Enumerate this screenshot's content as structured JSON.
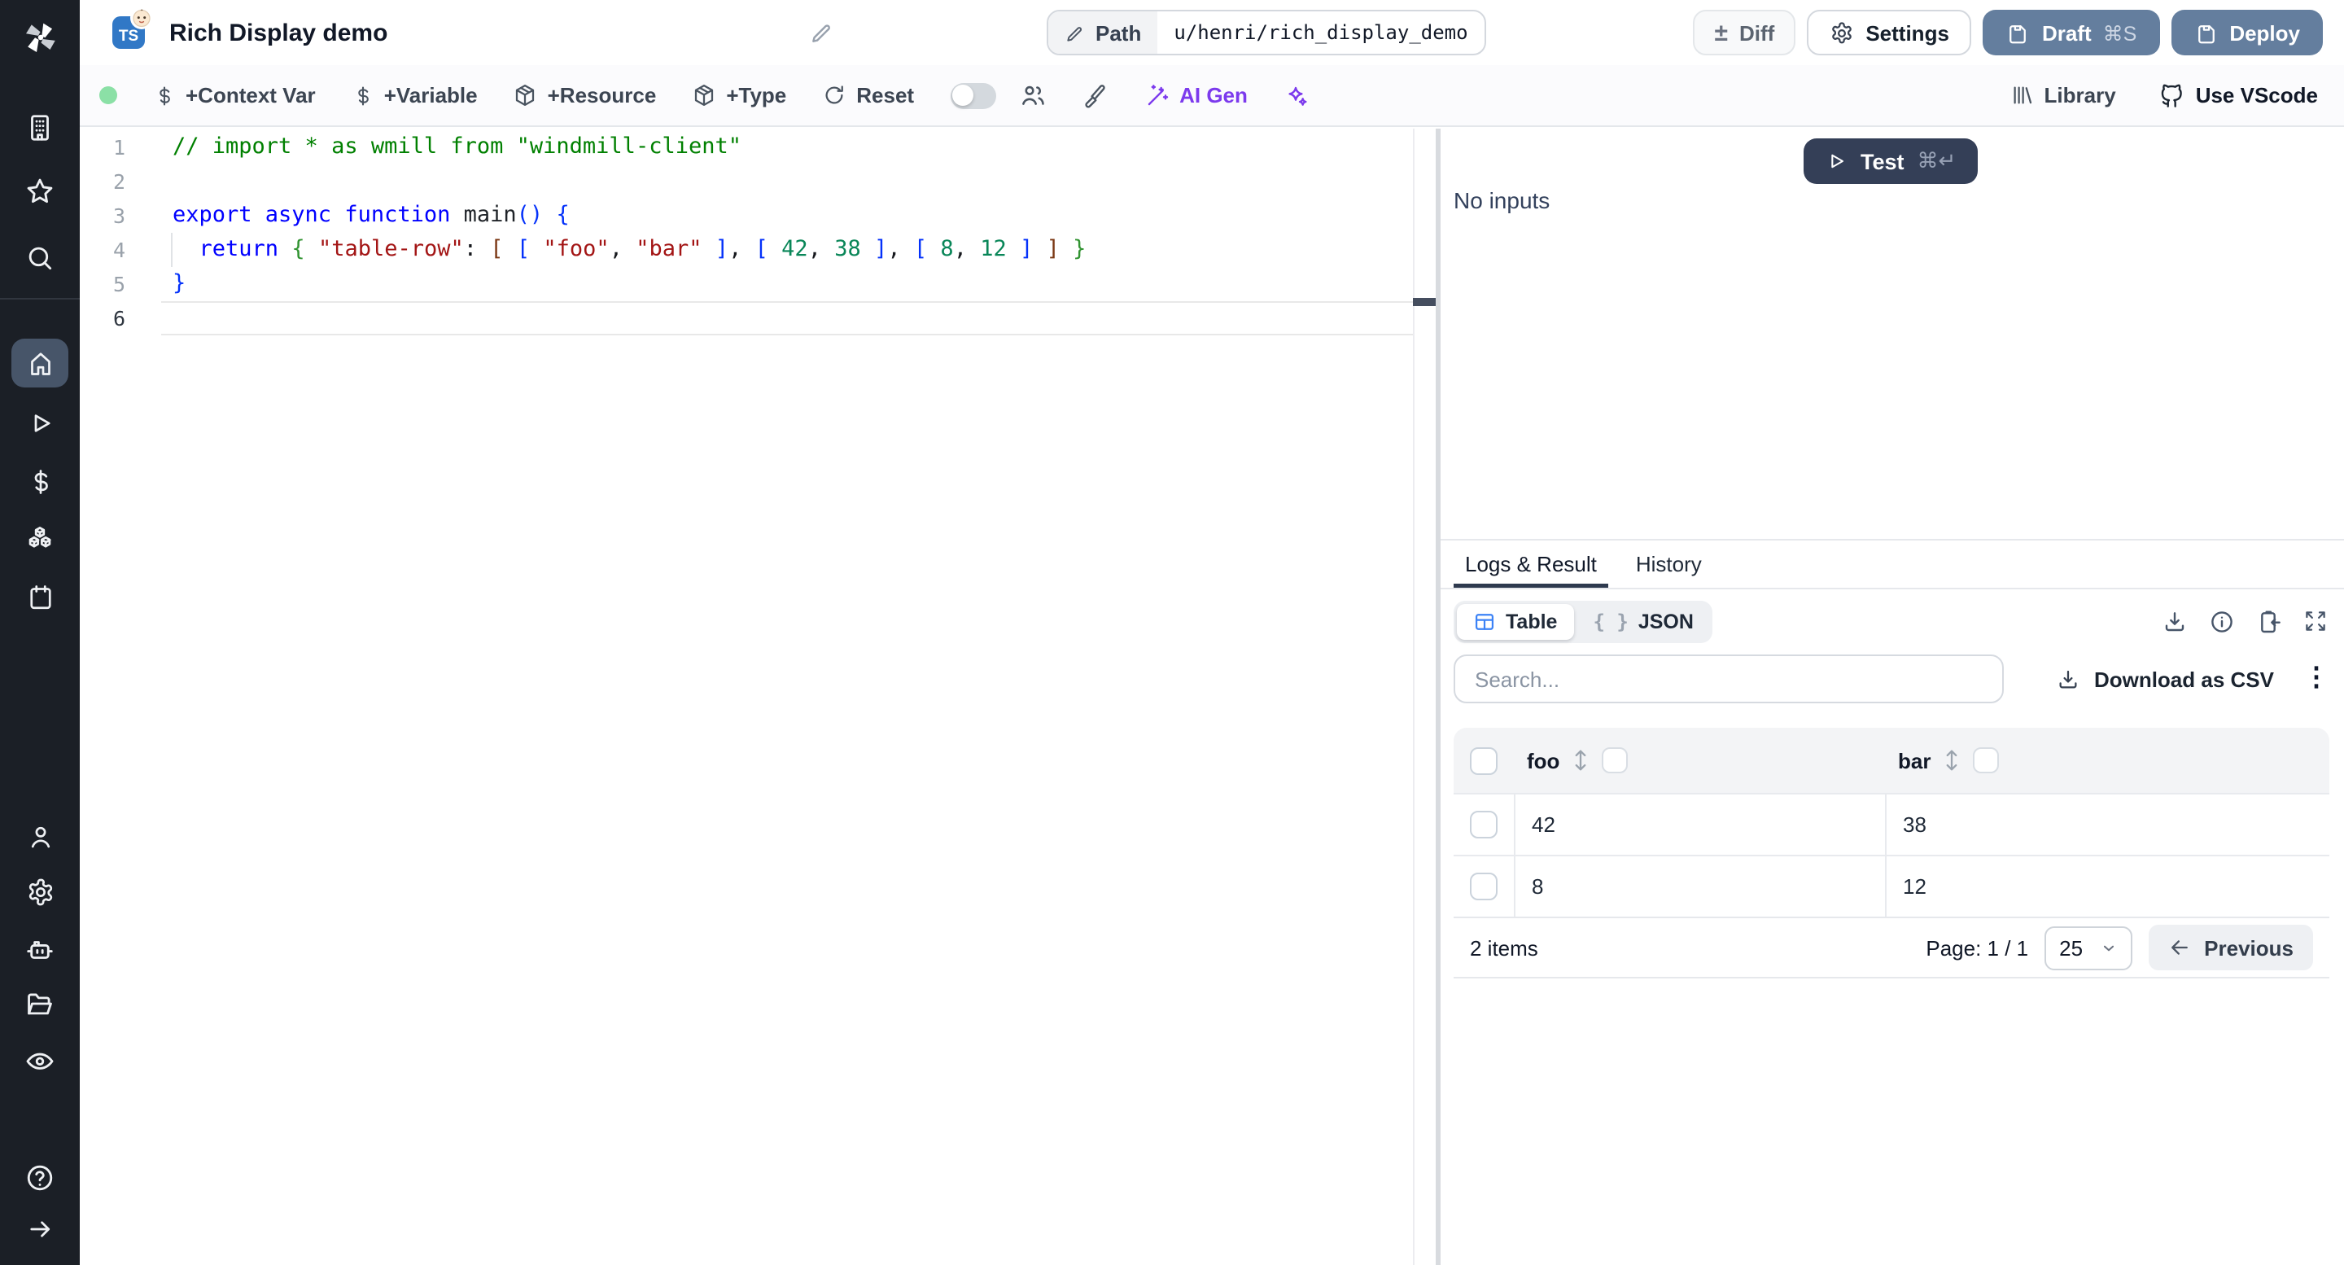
{
  "topbar": {
    "title": "Rich Display demo",
    "path_label": "Path",
    "path_value": "u/henri/rich_display_demo",
    "diff": "Diff",
    "settings": "Settings",
    "draft": "Draft",
    "draft_shortcut": "⌘S",
    "deploy": "Deploy"
  },
  "toolbar": {
    "context_var": "+Context Var",
    "variable": "+Variable",
    "resource": "+Resource",
    "type": "+Type",
    "reset": "Reset",
    "ai_gen": "AI Gen",
    "library": "Library",
    "vscode": "Use VScode",
    "accent_purple": "#7c3aed",
    "status_color": "#8be0a6"
  },
  "sidebar": {
    "icons": [
      "windmill-logo",
      "building",
      "star",
      "search",
      "home",
      "play",
      "dollar",
      "boxes",
      "calendar",
      "user",
      "settings",
      "bot",
      "folder-open",
      "eye",
      "help-circle",
      "arrow-right"
    ],
    "active_item": "home"
  },
  "icons_glyphs": {
    "plus_minus": "±",
    "kebab": "⋮",
    "braces": "{ }"
  },
  "editor": {
    "language_badge": "TS",
    "lines": [
      {
        "n": 1,
        "tokens": [
          {
            "c": "cmt",
            "t": "// import * as wmill from \"windmill-client\""
          }
        ]
      },
      {
        "n": 2,
        "tokens": []
      },
      {
        "n": 3,
        "tokens": [
          {
            "c": "kw",
            "t": "export async function "
          },
          {
            "c": "fn",
            "t": "main"
          },
          {
            "c": "b1",
            "t": "()"
          },
          {
            "c": "pl",
            "t": " "
          },
          {
            "c": "b1",
            "t": "{"
          }
        ]
      },
      {
        "n": 4,
        "tokens": [
          {
            "c": "pl",
            "t": "  "
          },
          {
            "c": "kw",
            "t": "return"
          },
          {
            "c": "pl",
            "t": " "
          },
          {
            "c": "b2",
            "t": "{"
          },
          {
            "c": "pl",
            "t": " "
          },
          {
            "c": "str",
            "t": "\"table-row\""
          },
          {
            "c": "pl",
            "t": ": "
          },
          {
            "c": "b3",
            "t": "["
          },
          {
            "c": "pl",
            "t": " "
          },
          {
            "c": "b1",
            "t": "["
          },
          {
            "c": "pl",
            "t": " "
          },
          {
            "c": "str",
            "t": "\"foo\""
          },
          {
            "c": "pl",
            "t": ", "
          },
          {
            "c": "str",
            "t": "\"bar\""
          },
          {
            "c": "pl",
            "t": " "
          },
          {
            "c": "b1",
            "t": "]"
          },
          {
            "c": "pl",
            "t": ", "
          },
          {
            "c": "b1",
            "t": "["
          },
          {
            "c": "pl",
            "t": " "
          },
          {
            "c": "num",
            "t": "42"
          },
          {
            "c": "pl",
            "t": ", "
          },
          {
            "c": "num",
            "t": "38"
          },
          {
            "c": "pl",
            "t": " "
          },
          {
            "c": "b1",
            "t": "]"
          },
          {
            "c": "pl",
            "t": ", "
          },
          {
            "c": "b1",
            "t": "["
          },
          {
            "c": "pl",
            "t": " "
          },
          {
            "c": "num",
            "t": "8"
          },
          {
            "c": "pl",
            "t": ", "
          },
          {
            "c": "num",
            "t": "12"
          },
          {
            "c": "pl",
            "t": " "
          },
          {
            "c": "b1",
            "t": "]"
          },
          {
            "c": "pl",
            "t": " "
          },
          {
            "c": "b3",
            "t": "]"
          },
          {
            "c": "pl",
            "t": " "
          },
          {
            "c": "b2",
            "t": "}"
          }
        ]
      },
      {
        "n": 5,
        "tokens": [
          {
            "c": "b1",
            "t": "}"
          }
        ]
      },
      {
        "n": 6,
        "tokens": [],
        "active": true
      }
    ]
  },
  "run": {
    "test": "Test",
    "test_shortcut": "⌘↵",
    "no_inputs": "No inputs"
  },
  "result": {
    "tabs": [
      {
        "label": "Logs & Result",
        "active": true
      },
      {
        "label": "History",
        "active": false
      }
    ],
    "views": [
      {
        "label": "Table",
        "active": true
      },
      {
        "label": "JSON",
        "active": false
      }
    ],
    "action_icons": [
      "download-icon",
      "info-icon",
      "clipboard-copy-icon",
      "expand-icon"
    ],
    "search_placeholder": "Search...",
    "download_csv": "Download as CSV",
    "table": {
      "columns": [
        "foo",
        "bar"
      ],
      "rows": [
        [
          "42",
          "38"
        ],
        [
          "8",
          "12"
        ]
      ]
    },
    "footer": {
      "count": "2 items",
      "page": "Page: 1 / 1",
      "page_size": "25",
      "previous": "Previous"
    }
  }
}
